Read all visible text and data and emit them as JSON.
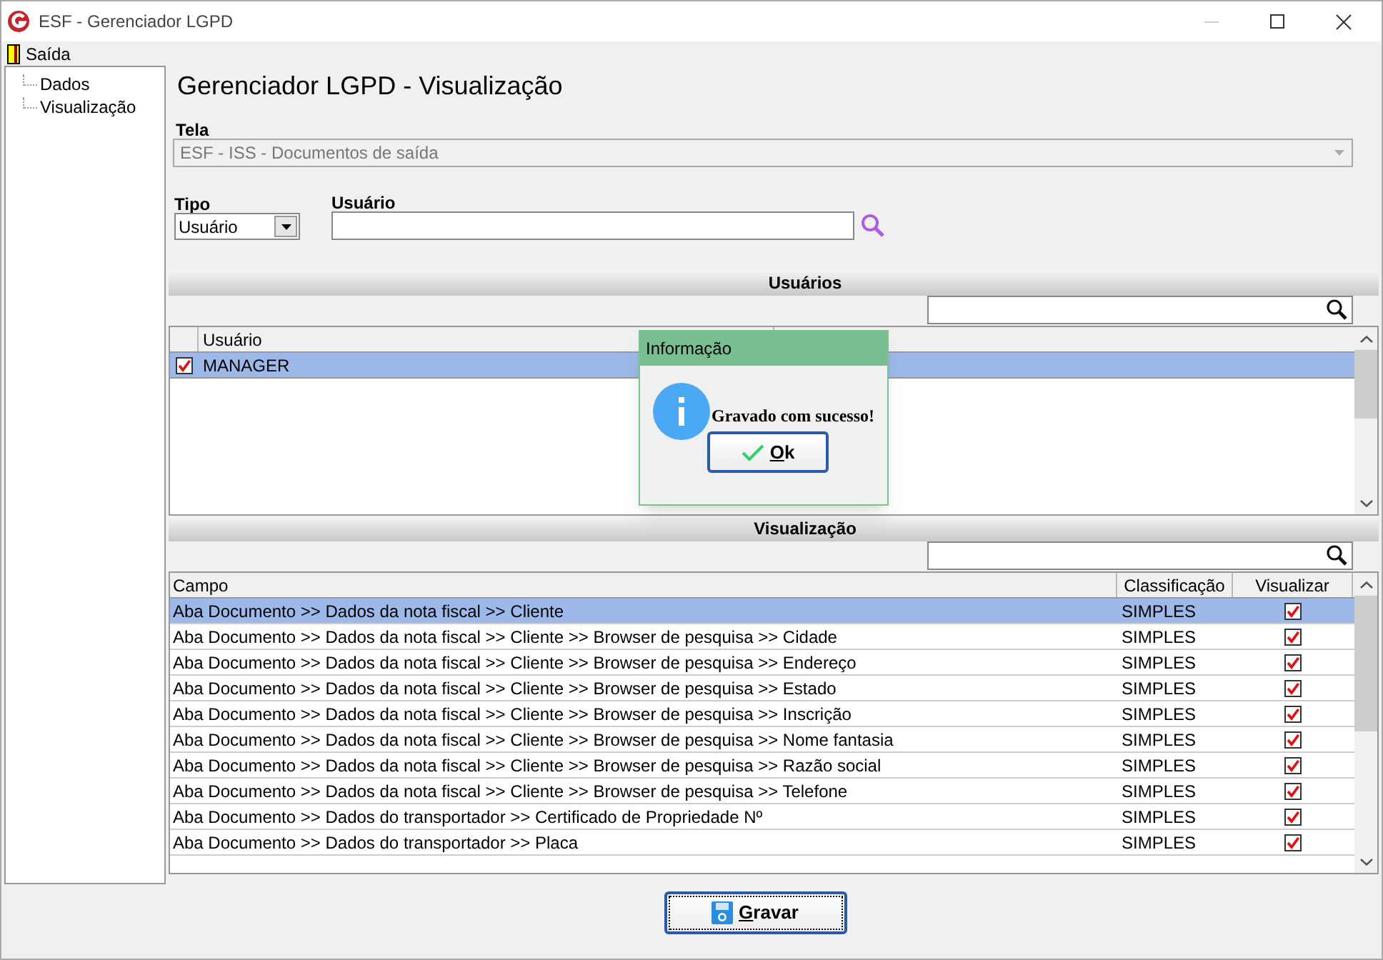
{
  "window": {
    "title": "ESF - Gerenciador LGPD"
  },
  "menu": [
    {
      "label": "Saída"
    }
  ],
  "tree": [
    {
      "label": "Dados"
    },
    {
      "label": "Visualização"
    }
  ],
  "heading": "Gerenciador LGPD - Visualização",
  "tela": {
    "label": "Tela",
    "value": "ESF - ISS - Documentos de saída",
    "disabled": true
  },
  "tipo": {
    "label": "Tipo",
    "value": "Usuário"
  },
  "usuario": {
    "label": "Usuário"
  },
  "usuarios_panel": {
    "title": "Usuários",
    "columns": [
      "Usuário"
    ],
    "rows": [
      {
        "usuario": "MANAGER",
        "checked": true,
        "selected": true
      }
    ]
  },
  "visualizacao_panel": {
    "title": "Visualização",
    "columns": [
      "Campo",
      "Classificação",
      "Visualizar"
    ],
    "rows": [
      {
        "campo": "Aba Documento >> Dados da nota fiscal >> Cliente",
        "classificacao": "SIMPLES",
        "visualizar": true,
        "selected": true
      },
      {
        "campo": "Aba Documento >> Dados da nota fiscal >> Cliente >> Browser de pesquisa >> Cidade",
        "classificacao": "SIMPLES",
        "visualizar": true,
        "selected": false
      },
      {
        "campo": "Aba Documento >> Dados da nota fiscal >> Cliente >> Browser de pesquisa >> Endereço",
        "classificacao": "SIMPLES",
        "visualizar": true,
        "selected": false
      },
      {
        "campo": "Aba Documento >> Dados da nota fiscal >> Cliente >> Browser de pesquisa >> Estado",
        "classificacao": "SIMPLES",
        "visualizar": true,
        "selected": false
      },
      {
        "campo": "Aba Documento >> Dados da nota fiscal >> Cliente >> Browser de pesquisa >> Inscrição",
        "classificacao": "SIMPLES",
        "visualizar": true,
        "selected": false
      },
      {
        "campo": "Aba Documento >> Dados da nota fiscal >> Cliente >> Browser de pesquisa >> Nome fantasia",
        "classificacao": "SIMPLES",
        "visualizar": true,
        "selected": false
      },
      {
        "campo": "Aba Documento >> Dados da nota fiscal >> Cliente >> Browser de pesquisa >> Razão social",
        "classificacao": "SIMPLES",
        "visualizar": true,
        "selected": false
      },
      {
        "campo": "Aba Documento >> Dados da nota fiscal >> Cliente >> Browser de pesquisa >> Telefone",
        "classificacao": "SIMPLES",
        "visualizar": true,
        "selected": false
      },
      {
        "campo": "Aba Documento >> Dados do transportador >> Certificado de Propriedade Nº",
        "classificacao": "SIMPLES",
        "visualizar": true,
        "selected": false
      },
      {
        "campo": "Aba Documento >> Dados do transportador >> Placa",
        "classificacao": "SIMPLES",
        "visualizar": true,
        "selected": false
      }
    ]
  },
  "dialog": {
    "title": "Informação",
    "message": "Gravado com sucesso!",
    "button": "Ok"
  },
  "save_button": "Gravar"
}
